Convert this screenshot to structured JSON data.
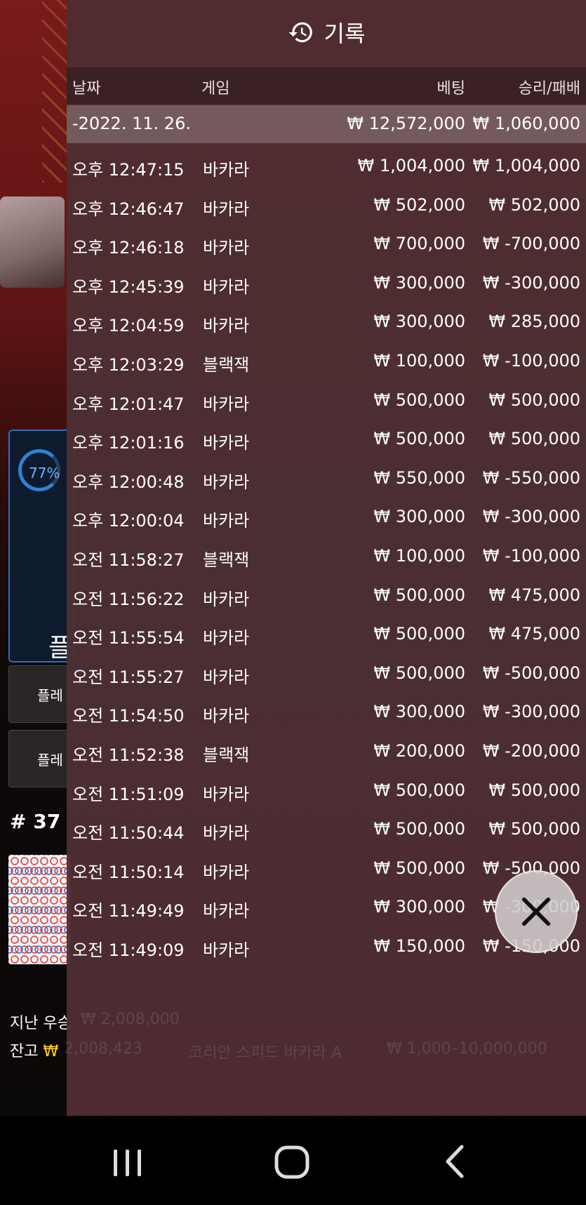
{
  "history": {
    "title": "기록",
    "columns": {
      "date": "날짜",
      "game": "게임",
      "bet": "베팅",
      "result": "승리/패배"
    },
    "date_group": {
      "date": "-2022. 11. 26.",
      "total_bet": "₩ 12,572,000",
      "total_result": "₩ 1,060,000"
    },
    "rows": [
      {
        "time": "오후 12:47:15",
        "game": "바카라",
        "bet": "₩ 1,004,000",
        "result": "₩ 1,004,000"
      },
      {
        "time": "오후 12:46:47",
        "game": "바카라",
        "bet": "₩ 502,000",
        "result": "₩ 502,000"
      },
      {
        "time": "오후 12:46:18",
        "game": "바카라",
        "bet": "₩ 700,000",
        "result": "₩ -700,000"
      },
      {
        "time": "오후 12:45:39",
        "game": "바카라",
        "bet": "₩ 300,000",
        "result": "₩ -300,000"
      },
      {
        "time": "오후 12:04:59",
        "game": "바카라",
        "bet": "₩ 300,000",
        "result": "₩ 285,000"
      },
      {
        "time": "오후 12:03:29",
        "game": "블랙잭",
        "bet": "₩ 100,000",
        "result": "₩ -100,000"
      },
      {
        "time": "오후 12:01:47",
        "game": "바카라",
        "bet": "₩ 500,000",
        "result": "₩ 500,000"
      },
      {
        "time": "오후 12:01:16",
        "game": "바카라",
        "bet": "₩ 500,000",
        "result": "₩ 500,000"
      },
      {
        "time": "오후 12:00:48",
        "game": "바카라",
        "bet": "₩ 550,000",
        "result": "₩ -550,000"
      },
      {
        "time": "오후 12:00:04",
        "game": "바카라",
        "bet": "₩ 300,000",
        "result": "₩ -300,000"
      },
      {
        "time": "오전 11:58:27",
        "game": "블랙잭",
        "bet": "₩ 100,000",
        "result": "₩ -100,000"
      },
      {
        "time": "오전 11:56:22",
        "game": "바카라",
        "bet": "₩ 500,000",
        "result": "₩ 475,000"
      },
      {
        "time": "오전 11:55:54",
        "game": "바카라",
        "bet": "₩ 500,000",
        "result": "₩ 475,000"
      },
      {
        "time": "오전 11:55:27",
        "game": "바카라",
        "bet": "₩ 500,000",
        "result": "₩ -500,000"
      },
      {
        "time": "오전 11:54:50",
        "game": "바카라",
        "bet": "₩ 300,000",
        "result": "₩ -300,000"
      },
      {
        "time": "오전 11:52:38",
        "game": "블랙잭",
        "bet": "₩ 200,000",
        "result": "₩ -200,000"
      },
      {
        "time": "오전 11:51:09",
        "game": "바카라",
        "bet": "₩ 500,000",
        "result": "₩ 500,000"
      },
      {
        "time": "오전 11:50:44",
        "game": "바카라",
        "bet": "₩ 500,000",
        "result": "₩ 500,000"
      },
      {
        "time": "오전 11:50:14",
        "game": "바카라",
        "bet": "₩ 500,000",
        "result": "₩ -500,000"
      },
      {
        "time": "오전 11:49:49",
        "game": "바카라",
        "bet": "₩ 300,000",
        "result": "₩ -300,000"
      },
      {
        "time": "오전 11:49:09",
        "game": "바카라",
        "bet": "₩ 150,000",
        "result": "₩ -150,000"
      }
    ]
  },
  "background": {
    "stat_percent": "77%",
    "stat_label_partial": "플",
    "side_button_1": "플레",
    "side_button_2": "플레",
    "shoe_number": "# 37",
    "last_win_label": "지난 우승",
    "last_win_value": "₩ 2,008,000",
    "balance_label": "잔고",
    "balance_currency": "₩",
    "balance_value": "2,008,423",
    "table_name": "코리안 스피드 바카라 A",
    "table_limits": "₩ 1,000–10,000,000"
  },
  "icons": {
    "title_icon": "history-icon",
    "close_icon": "close-icon",
    "nav_recent": "recent-apps-icon",
    "nav_home": "home-icon",
    "nav_back": "back-icon"
  },
  "colors": {
    "panel_bg": "#4e2c30",
    "balance_currency": "#ffd21a",
    "stat_ring": "#2f82d6"
  }
}
